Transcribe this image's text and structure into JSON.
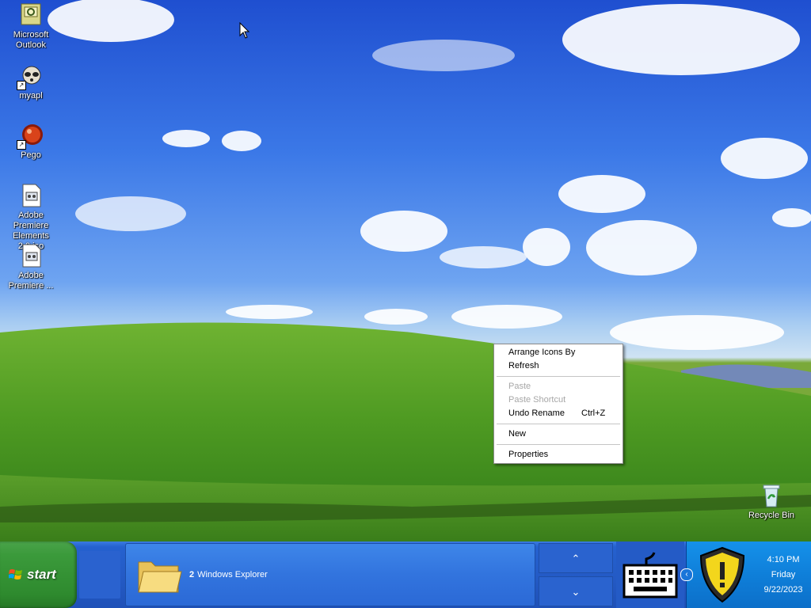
{
  "desktop": {
    "icons": [
      {
        "label": "Microsoft Outlook",
        "name": "outlook-icon"
      },
      {
        "label": "myapl",
        "name": "myapl-icon"
      },
      {
        "label": "Pego",
        "name": "pego-icon"
      },
      {
        "label": "Adobe Premiere Elements 2.0.iso",
        "name": "iso-file-icon"
      },
      {
        "label": "Adobe Premiere ...",
        "name": "premiere-file-icon"
      },
      {
        "label": "Recycle Bin",
        "name": "recycle-bin-icon"
      }
    ]
  },
  "context_menu": {
    "items": [
      {
        "label": "Arrange Icons By",
        "enabled": true
      },
      {
        "label": "Refresh",
        "enabled": true
      },
      {
        "label": "Paste",
        "enabled": false
      },
      {
        "label": "Paste Shortcut",
        "enabled": false
      },
      {
        "label": "Undo Rename",
        "accelerator": "Ctrl+Z",
        "enabled": true
      },
      {
        "label": "New",
        "enabled": true
      },
      {
        "label": "Properties",
        "enabled": true
      }
    ]
  },
  "taskbar": {
    "start_label": "start",
    "task_group": {
      "count": "2",
      "label": "Windows Explorer"
    },
    "scroll_up": "⌃",
    "scroll_down": "⌄",
    "clock": {
      "time": "4:10 PM",
      "day": "Friday",
      "date": "9/22/2023"
    }
  },
  "colors": {
    "sky": "#3b78e7",
    "hill": "#5e9d2a",
    "taskbar": "#245bc6",
    "start_green": "#3b9a3b",
    "tray": "#0f7fd9"
  }
}
